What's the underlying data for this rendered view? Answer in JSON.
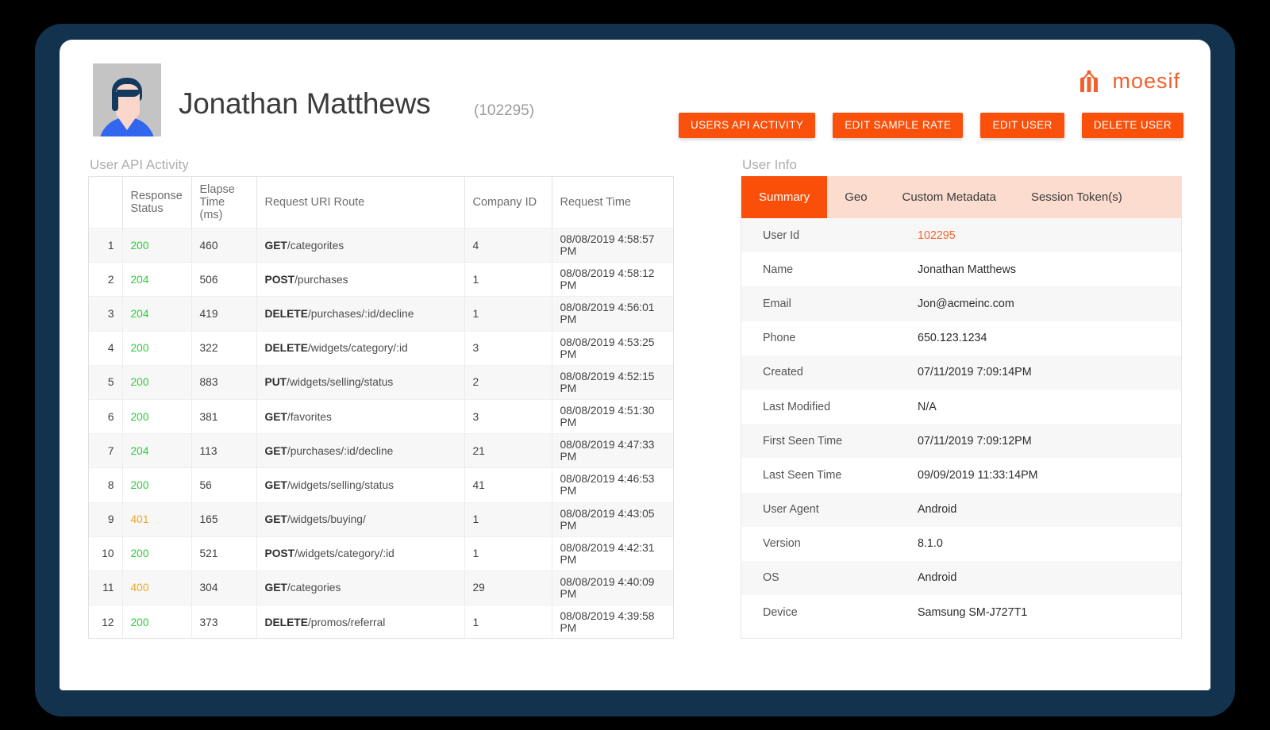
{
  "header": {
    "user_name": "Jonathan Matthews",
    "user_id_display": "(102295)",
    "avatar_alt": "user-avatar",
    "logo_word": "moesif"
  },
  "actions": [
    {
      "label": "USERS API ACTIVITY",
      "name": "users-api-activity-button"
    },
    {
      "label": "EDIT SAMPLE RATE",
      "name": "edit-sample-rate-button"
    },
    {
      "label": "EDIT USER",
      "name": "edit-user-button"
    },
    {
      "label": "DELETE USER",
      "name": "delete-user-button"
    }
  ],
  "sections": {
    "left_caption": "User API Activity",
    "right_caption": "User Info"
  },
  "activity_table": {
    "columns": [
      "",
      "Response Status",
      "Elapse Time (ms)",
      "Request URI Route",
      "Company ID",
      "Request Time"
    ],
    "rows": [
      {
        "idx": "1",
        "status": "200",
        "status_kind": "ok",
        "elapse": "460",
        "verb": "GET",
        "path": "/categorites",
        "company": "4",
        "time": "08/08/2019 4:58:57 PM"
      },
      {
        "idx": "2",
        "status": "204",
        "status_kind": "ok",
        "elapse": "506",
        "verb": "POST",
        "path": "/purchases",
        "company": "1",
        "time": "08/08/2019 4:58:12 PM"
      },
      {
        "idx": "3",
        "status": "204",
        "status_kind": "ok",
        "elapse": "419",
        "verb": "DELETE",
        "path": "/purchases/:id/decline",
        "company": "1",
        "time": "08/08/2019 4:56:01 PM"
      },
      {
        "idx": "4",
        "status": "200",
        "status_kind": "ok",
        "elapse": "322",
        "verb": "DELETE",
        "path": "/widgets/category/:id",
        "company": "3",
        "time": "08/08/2019 4:53:25 PM"
      },
      {
        "idx": "5",
        "status": "200",
        "status_kind": "ok",
        "elapse": "883",
        "verb": "PUT",
        "path": "/widgets/selling/status",
        "company": "2",
        "time": "08/08/2019 4:52:15 PM"
      },
      {
        "idx": "6",
        "status": "200",
        "status_kind": "ok",
        "elapse": "381",
        "verb": "GET",
        "path": "/favorites",
        "company": "3",
        "time": "08/08/2019 4:51:30 PM"
      },
      {
        "idx": "7",
        "status": "204",
        "status_kind": "ok",
        "elapse": "113",
        "verb": "GET",
        "path": "/purchases/:id/decline",
        "company": "21",
        "time": "08/08/2019 4:47:33 PM"
      },
      {
        "idx": "8",
        "status": "200",
        "status_kind": "ok",
        "elapse": "56",
        "verb": "GET",
        "path": "/widgets/selling/status",
        "company": "41",
        "time": "08/08/2019 4:46:53 PM"
      },
      {
        "idx": "9",
        "status": "401",
        "status_kind": "warn",
        "elapse": "165",
        "verb": "GET",
        "path": "/widgets/buying/",
        "company": "1",
        "time": "08/08/2019 4:43:05 PM"
      },
      {
        "idx": "10",
        "status": "200",
        "status_kind": "ok",
        "elapse": "521",
        "verb": "POST",
        "path": "/widgets/category/:id",
        "company": "1",
        "time": "08/08/2019 4:42:31 PM"
      },
      {
        "idx": "11",
        "status": "400",
        "status_kind": "warn",
        "elapse": "304",
        "verb": "GET",
        "path": "/categories",
        "company": "29",
        "time": "08/08/2019 4:40:09 PM"
      },
      {
        "idx": "12",
        "status": "200",
        "status_kind": "ok",
        "elapse": "373",
        "verb": "DELETE",
        "path": "/promos/referral",
        "company": "1",
        "time": "08/08/2019 4:39:58 PM"
      }
    ]
  },
  "user_info": {
    "tabs": [
      {
        "label": "Summary",
        "active": true
      },
      {
        "label": "Geo",
        "active": false
      },
      {
        "label": "Custom Metadata",
        "active": false
      },
      {
        "label": "Session Token(s)",
        "active": false
      }
    ],
    "rows": [
      {
        "key": "User Id",
        "value": "102295",
        "accent": true
      },
      {
        "key": "Name",
        "value": "Jonathan Matthews",
        "accent": false
      },
      {
        "key": "Email",
        "value": "Jon@acmeinc.com",
        "accent": false
      },
      {
        "key": "Phone",
        "value": "650.123.1234",
        "accent": false
      },
      {
        "key": "Created",
        "value": "07/11/2019 7:09:14PM",
        "accent": false
      },
      {
        "key": "Last Modified",
        "value": "N/A",
        "accent": false
      },
      {
        "key": "First Seen Time",
        "value": "07/11/2019 7:09:12PM",
        "accent": false
      },
      {
        "key": "Last Seen Time",
        "value": "09/09/2019 11:33:14PM",
        "accent": false
      },
      {
        "key": "User Agent",
        "value": "Android",
        "accent": false
      },
      {
        "key": "Version",
        "value": "8.1.0",
        "accent": false
      },
      {
        "key": "OS",
        "value": "Android",
        "accent": false
      },
      {
        "key": "Device",
        "value": "Samsung SM-J727T1",
        "accent": false
      }
    ]
  },
  "colors": {
    "brand_orange": "#f9500b",
    "tab_inactive_bg": "#fbdccf",
    "frame_navy": "#13324e",
    "status_ok_green": "#2ecc3b",
    "status_warn_amber": "#f5a623",
    "accent_link": "#f1672e"
  }
}
